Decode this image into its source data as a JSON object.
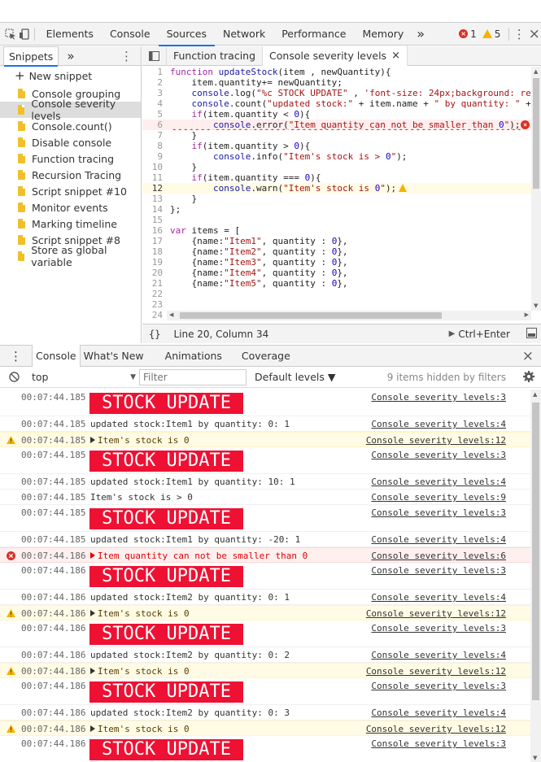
{
  "toolbar": {
    "tabs": [
      "Elements",
      "Console",
      "Sources",
      "Network",
      "Performance",
      "Memory"
    ],
    "more": "»",
    "error_count": "1",
    "warning_count": "5"
  },
  "navigator": {
    "tab_label": "Snippets",
    "more": "»",
    "new_snippet": "New snippet",
    "items": [
      "Console grouping",
      "Console severity levels",
      "Console.count()",
      "Disable console",
      "Function tracing",
      "Recursion Tracing",
      "Script snippet #10",
      "Monitor events",
      "Marking timeline",
      "Script snippet #8",
      "Store as global variable"
    ]
  },
  "editor": {
    "tabs": [
      "Function tracing",
      "Console severity levels"
    ],
    "close": "×",
    "lines": [
      "function updateStock(item , newQuantity){",
      "    item.quantity+= newQuantity;",
      "    console.log(\"%c STOCK UPDATE\" , 'font-size: 24px;background: re",
      "    console.count(\"updated stock:\" + item.name + \" by quantity: \" +",
      "    if(item.quantity < 0){",
      "        console.error(\"Item quantity can not be smaller than 0\");",
      "    }",
      "    if(item.quantity > 0){",
      "        console.info(\"Item's stock is > 0\");",
      "    }",
      "    if(item.quantity === 0){",
      "        console.warn(\"Item's stock is 0\");",
      "    }",
      "};",
      "",
      "var items = [",
      "    {name:\"Item1\", quantity : 0},",
      "    {name:\"Item2\", quantity : 0},",
      "    {name:\"Item3\", quantity : 0},",
      "    {name:\"Item4\", quantity : 0},",
      "    {name:\"Item5\", quantity : 0},",
      "",
      "",
      "];"
    ],
    "status_position": "Line 20, Column 34",
    "run_shortcut": "Ctrl+Enter"
  },
  "drawer": {
    "tabs": [
      "Console",
      "What's New",
      "Animations",
      "Coverage"
    ],
    "close": "×",
    "context": "top",
    "filter_placeholder": "Filter",
    "levels": "Default levels ▼",
    "hidden_note": "9 items hidden by filters"
  },
  "console_messages": [
    {
      "type": "styled",
      "time": "00:07:44.185",
      "text": "STOCK UPDATE",
      "source": "Console severity levels:3"
    },
    {
      "type": "log",
      "time": "00:07:44.185",
      "text": "updated stock:Item1 by quantity: 0: 1",
      "source": "Console severity levels:4"
    },
    {
      "type": "warn",
      "time": "00:07:44.185",
      "text": "Item's stock is 0",
      "source": "Console severity levels:12"
    },
    {
      "type": "styled",
      "time": "00:07:44.185",
      "text": "STOCK UPDATE",
      "source": "Console severity levels:3"
    },
    {
      "type": "log",
      "time": "00:07:44.185",
      "text": "updated stock:Item1 by quantity: 10: 1",
      "source": "Console severity levels:4"
    },
    {
      "type": "log",
      "time": "00:07:44.185",
      "text": "Item's stock is > 0",
      "source": "Console severity levels:9"
    },
    {
      "type": "styled",
      "time": "00:07:44.185",
      "text": "STOCK UPDATE",
      "source": "Console severity levels:3"
    },
    {
      "type": "log",
      "time": "00:07:44.185",
      "text": "updated stock:Item1 by quantity: -20: 1",
      "source": "Console severity levels:4"
    },
    {
      "type": "error",
      "time": "00:07:44.186",
      "text": "Item quantity can not be smaller than 0",
      "source": "Console severity levels:6"
    },
    {
      "type": "styled",
      "time": "00:07:44.186",
      "text": "STOCK UPDATE",
      "source": "Console severity levels:3"
    },
    {
      "type": "log",
      "time": "00:07:44.186",
      "text": "updated stock:Item2 by quantity: 0: 1",
      "source": "Console severity levels:4"
    },
    {
      "type": "warn",
      "time": "00:07:44.186",
      "text": "Item's stock is 0",
      "source": "Console severity levels:12"
    },
    {
      "type": "styled",
      "time": "00:07:44.186",
      "text": "STOCK UPDATE",
      "source": "Console severity levels:3"
    },
    {
      "type": "log",
      "time": "00:07:44.186",
      "text": "updated stock:Item2 by quantity: 0: 2",
      "source": "Console severity levels:4"
    },
    {
      "type": "warn",
      "time": "00:07:44.186",
      "text": "Item's stock is 0",
      "source": "Console severity levels:12"
    },
    {
      "type": "styled",
      "time": "00:07:44.186",
      "text": "STOCK UPDATE",
      "source": "Console severity levels:3"
    },
    {
      "type": "log",
      "time": "00:07:44.186",
      "text": "updated stock:Item2 by quantity: 0: 3",
      "source": "Console severity levels:4"
    },
    {
      "type": "warn",
      "time": "00:07:44.186",
      "text": "Item's stock is 0",
      "source": "Console severity levels:12"
    },
    {
      "type": "styled",
      "time": "00:07:44.186",
      "text": "STOCK UPDATE",
      "source": "Console severity levels:3"
    }
  ],
  "colors": {
    "accent": "#1a73e8",
    "stock_update_bg": "#ee1133",
    "error": "#d93025",
    "warning": "#f4b400"
  }
}
